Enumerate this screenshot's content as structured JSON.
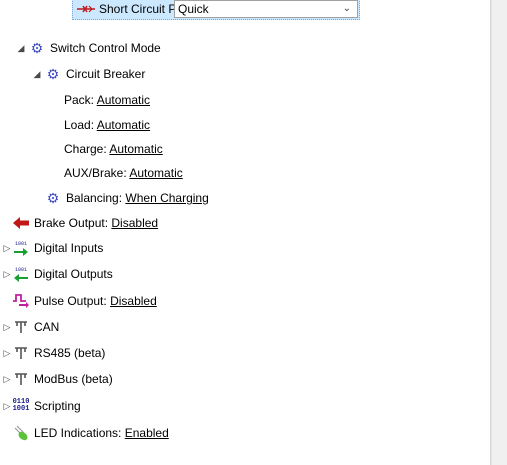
{
  "tree": {
    "short_circuit": {
      "label": "Short Circuit Protection:",
      "value": "Quick",
      "icon": "short-circuit-icon"
    },
    "switch_control": {
      "label": "Switch Control Mode",
      "icon": "gear-icon"
    },
    "circuit_breaker": {
      "label": "Circuit Breaker",
      "icon": "gear-icon"
    },
    "pack": {
      "label": "Pack:",
      "value": "Automatic"
    },
    "load": {
      "label": "Load:",
      "value": "Automatic"
    },
    "charge": {
      "label": "Charge:",
      "value": "Automatic"
    },
    "aux": {
      "label": "AUX/Brake:",
      "value": "Automatic"
    },
    "balancing": {
      "label": "Balancing:",
      "value": "When Charging",
      "icon": "gear-icon"
    },
    "brake_output": {
      "label": "Brake Output:",
      "value": "Disabled",
      "icon": "red-arrow-icon"
    },
    "digital_inputs": {
      "label": "Digital Inputs",
      "icon": "digital-input-icon"
    },
    "digital_outputs": {
      "label": "Digital Outputs",
      "icon": "digital-output-icon"
    },
    "pulse_output": {
      "label": "Pulse Output:",
      "value": "Disabled",
      "icon": "pulse-icon"
    },
    "can": {
      "label": "CAN",
      "icon": "antenna-icon"
    },
    "rs485": {
      "label": "RS485 (beta)",
      "icon": "antenna-icon"
    },
    "modbus": {
      "label": "ModBus (beta)",
      "icon": "antenna-icon"
    },
    "scripting": {
      "label": "Scripting",
      "icon": "binary-icon",
      "icon_text_top": "0110",
      "icon_text_bottom": "1001"
    },
    "led": {
      "label": "LED Indications:",
      "value": "Enabled",
      "icon": "led-icon"
    }
  },
  "colors": {
    "selection": "#cce8ff",
    "gear": "#3f4ec4",
    "brake": "#c01818"
  }
}
